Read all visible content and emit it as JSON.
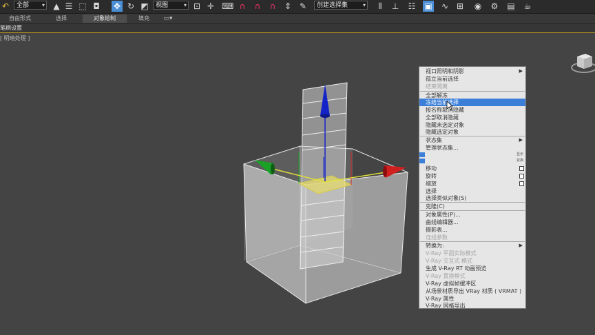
{
  "toolbar": {
    "filter_select": "全部",
    "coord_select": "视图",
    "named_selection": "创建选择集"
  },
  "ribbon_tabs": [
    {
      "label": "自由形式"
    },
    {
      "label": "选择"
    },
    {
      "label": "对象绘制"
    },
    {
      "label": "填充"
    }
  ],
  "ribbon_panel_label": "笔刷设置",
  "viewport_label": "[ 明暗处理 ]",
  "context_menu": {
    "items": [
      {
        "label": "视口照明和阴影",
        "submenu": true
      },
      {
        "label": "孤立当前选择"
      },
      {
        "label": "结束隔离",
        "disabled": true
      },
      {
        "label": "全部解冻"
      },
      {
        "label": "冻结当前选择",
        "highlighted": true
      },
      {
        "label": "按名称取消隐藏"
      },
      {
        "label": "全部取消隐藏"
      },
      {
        "label": "隐藏未选定对象"
      },
      {
        "label": "隐藏选定对象"
      },
      {
        "label": "状态集",
        "submenu": true
      },
      {
        "label": "管理状态集..."
      },
      {
        "label": "移动"
      },
      {
        "label": "旋转"
      },
      {
        "label": "缩放"
      },
      {
        "label": "选择"
      },
      {
        "label": "选择类似对象(S)"
      },
      {
        "label": "克隆(C)"
      },
      {
        "label": "对象属性(P)..."
      },
      {
        "label": "曲线编辑器..."
      },
      {
        "label": "摄影表..."
      },
      {
        "label": "连线参数",
        "disabled": true
      },
      {
        "label": "转换为:",
        "submenu": true
      },
      {
        "label": "V-Ray 平面实际模式",
        "disabled": true
      },
      {
        "label": "V-Ray 交互式 模式",
        "disabled": true
      },
      {
        "label": "生成 V-Ray RT 动画预览"
      },
      {
        "label": "V-Ray 置换模式",
        "disabled": true
      },
      {
        "label": "V-Ray 虚拟帧缓冲区"
      },
      {
        "label": "从场景材质导出 VRay 材质 ( VRMAT )"
      },
      {
        "label": "V-Ray 属性"
      },
      {
        "label": "V-Ray 网格导出"
      }
    ],
    "quad_labels": [
      "显示",
      "变换"
    ]
  },
  "colors": {
    "highlight": "#3b7fd9",
    "viewport_bg": "#444444",
    "axis_x": "#d11f1f",
    "axis_y": "#1aa024",
    "axis_z": "#1524c8"
  },
  "icons": [
    "select-object-icon",
    "select-region-icon",
    "move-icon",
    "rotate-icon",
    "scale-icon",
    "snap-icon",
    "angle-snap-icon",
    "percent-snap-icon",
    "mirror-icon",
    "align-icon",
    "layer-icon",
    "curve-editor-icon",
    "material-editor-icon",
    "render-setup-icon",
    "render-icon",
    "teapot-icon"
  ]
}
